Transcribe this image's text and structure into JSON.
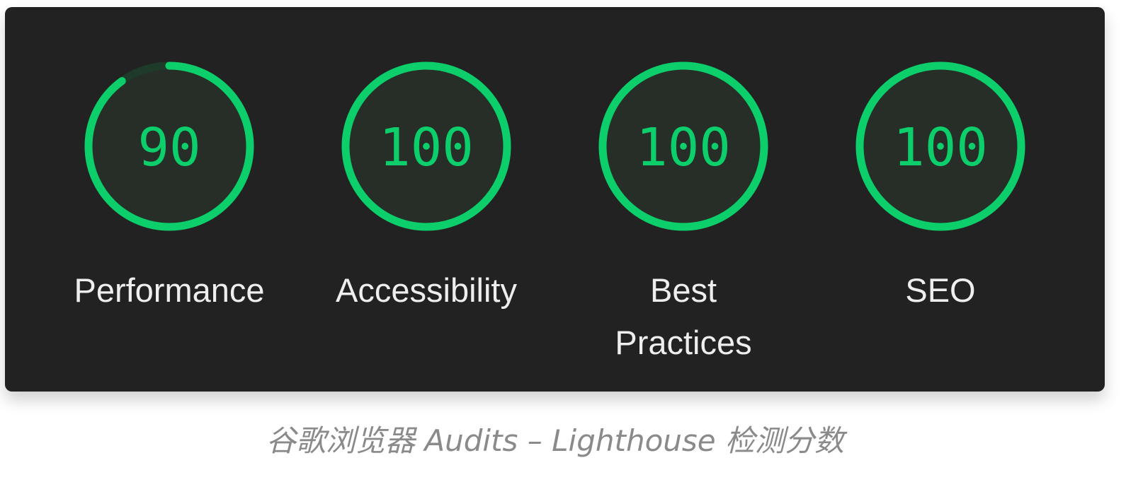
{
  "colors": {
    "panel_bg": "#222222",
    "gauge_arc": "#0cce6b",
    "gauge_fill": "#262e27",
    "gauge_track": "#1e3a29",
    "label_text": "#eeeeee",
    "caption_text": "#8a8a8a"
  },
  "gauges": [
    {
      "score": "90",
      "label": "Performance",
      "fraction": 0.9
    },
    {
      "score": "100",
      "label": "Accessibility",
      "fraction": 1.0
    },
    {
      "score": "100",
      "label": "Best Practices",
      "fraction": 1.0
    },
    {
      "score": "100",
      "label": "SEO",
      "fraction": 1.0
    }
  ],
  "caption": "谷歌浏览器 Audits – Lighthouse 检测分数"
}
